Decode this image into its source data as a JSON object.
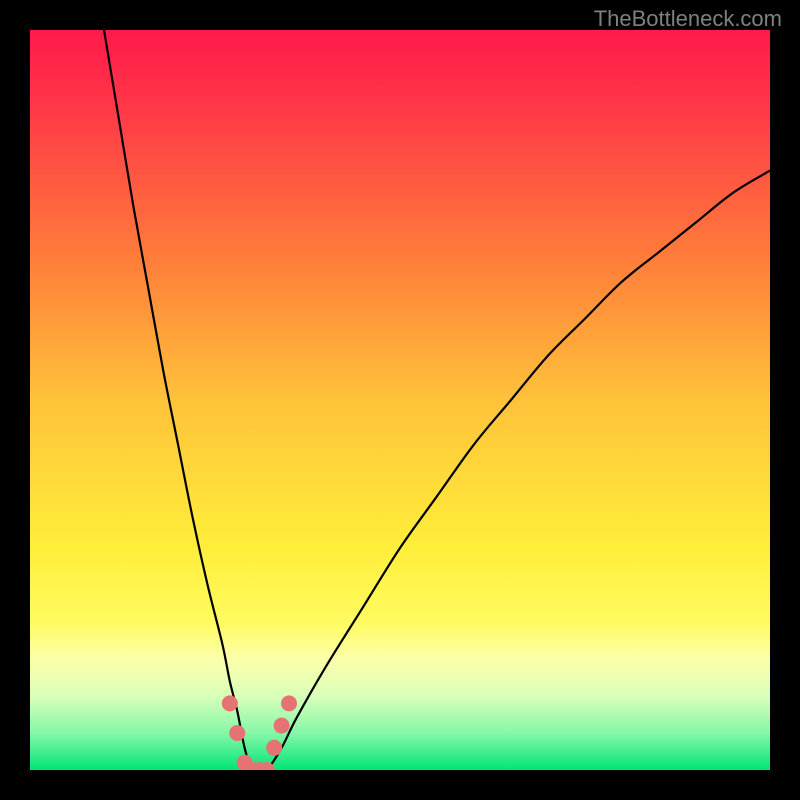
{
  "watermark": "TheBottleneck.com",
  "chart_data": {
    "type": "line",
    "title": "",
    "xlabel": "",
    "ylabel": "",
    "xlim": [
      0,
      100
    ],
    "ylim": [
      0,
      100
    ],
    "background_gradient": {
      "top": "#ff1a4a",
      "mid": "#ffea00",
      "bottom": "#00e676"
    },
    "series": [
      {
        "name": "curve",
        "x": [
          10,
          12,
          14,
          16,
          18,
          20,
          22,
          24,
          26,
          27,
          28,
          29,
          30,
          31,
          32,
          34,
          36,
          40,
          45,
          50,
          55,
          60,
          65,
          70,
          75,
          80,
          85,
          90,
          95,
          100
        ],
        "y": [
          100,
          88,
          76,
          65,
          54,
          44,
          34,
          25,
          17,
          12,
          8,
          3,
          0,
          0,
          0,
          3,
          7,
          14,
          22,
          30,
          37,
          44,
          50,
          56,
          61,
          66,
          70,
          74,
          78,
          81
        ]
      }
    ],
    "markers": {
      "name": "points",
      "color": "#e57373",
      "x": [
        27,
        28,
        29,
        30,
        31,
        32,
        33,
        34,
        35
      ],
      "y": [
        9,
        5,
        1,
        0,
        0,
        0,
        3,
        6,
        9
      ]
    }
  }
}
